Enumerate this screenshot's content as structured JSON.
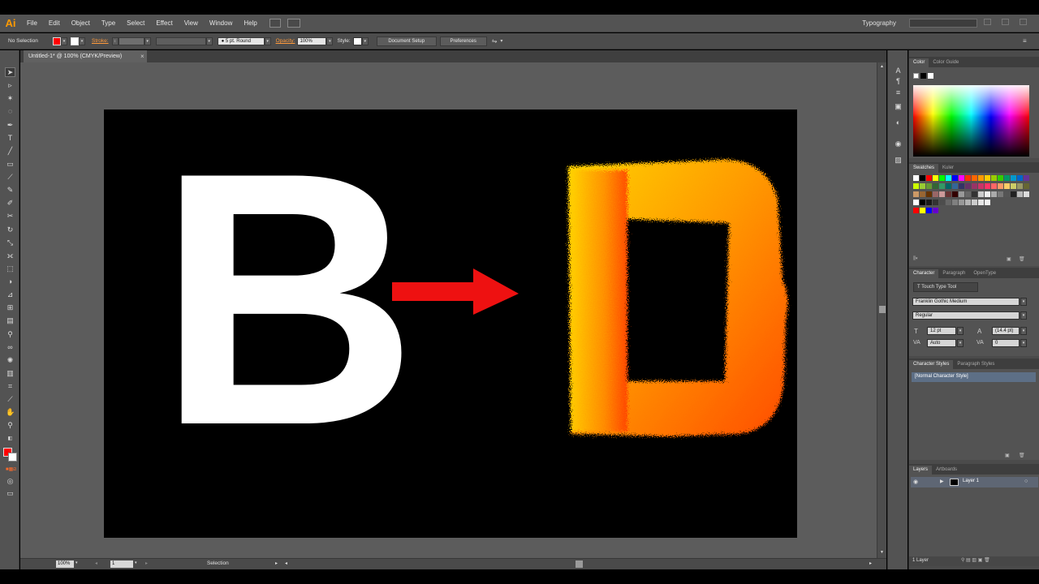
{
  "app": {
    "logo": "Ai",
    "workspace": "Typography"
  },
  "menu": [
    "File",
    "Edit",
    "Object",
    "Type",
    "Select",
    "Effect",
    "View",
    "Window",
    "Help"
  ],
  "control_bar": {
    "selection_status": "No Selection",
    "stroke_label": "Stroke:",
    "brush_value": "5 pt. Round",
    "opacity_label": "Opacity:",
    "opacity_value": "100%",
    "style_label": "Style:",
    "document_setup": "Document Setup",
    "preferences": "Preferences",
    "fill_color": "#ff0000"
  },
  "document": {
    "tab_title": "Untitled-1* @ 100% (CMYK/Preview)",
    "zoom": "100%",
    "artboard_number": "1",
    "status_tool": "Selection"
  },
  "artwork": {
    "left_letter": "B",
    "left_letter_color": "#ffffff",
    "arrow_color": "#ee1111",
    "fur_gradient": [
      "#ffd200",
      "#ff9a00",
      "#ff4c00"
    ]
  },
  "color_panel": {
    "tabs": [
      "Color",
      "Color Guide"
    ]
  },
  "swatches_panel": {
    "tabs": [
      "Swatches",
      "Kuler"
    ]
  },
  "character_panel": {
    "tabs": [
      "Character",
      "Paragraph",
      "OpenType"
    ],
    "touch_type_tool": "Touch Type Tool",
    "font_family": "Franklin Gothic Medium",
    "font_style": "Regular",
    "font_size": "12 pt",
    "leading": "(14.4 pt)",
    "kerning": "Auto",
    "tracking": "0"
  },
  "styles_panel": {
    "tabs": [
      "Character Styles",
      "Paragraph Styles"
    ],
    "items": [
      "[Normal Character Style]"
    ]
  },
  "layers_panel": {
    "tabs": [
      "Layers",
      "Artboards"
    ],
    "layers": [
      "Layer 1"
    ],
    "count_label": "1 Layer"
  }
}
